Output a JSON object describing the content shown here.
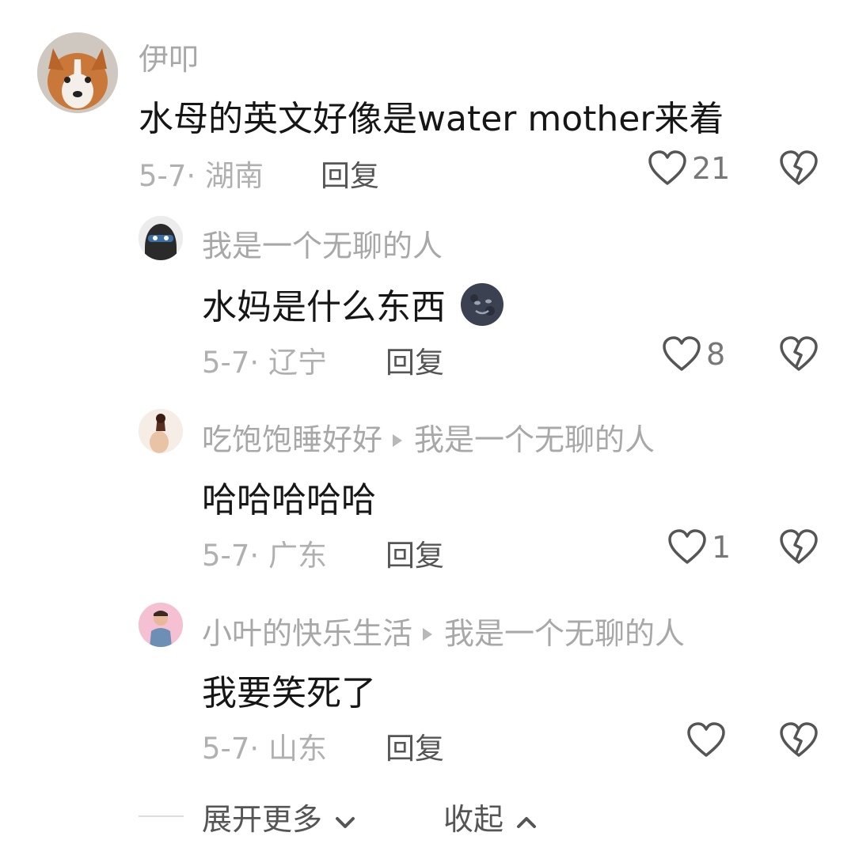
{
  "comments": [
    {
      "username": "伊叩",
      "text": "水母的英文好像是water mother来着",
      "date_location": "5-7· 湖南",
      "reply_label": "回复",
      "likes": "21",
      "reply_to": ""
    },
    {
      "username": "我是一个无聊的人",
      "text": "水妈是什么东西",
      "date_location": "5-7· 辽宁",
      "reply_label": "回复",
      "likes": "8",
      "reply_to": ""
    },
    {
      "username": "吃饱饱睡好好",
      "text": "哈哈哈哈哈",
      "date_location": "5-7· 广东",
      "reply_label": "回复",
      "likes": "1",
      "reply_to": "我是一个无聊的人"
    },
    {
      "username": "小叶的快乐生活",
      "text": "我要笑死了",
      "date_location": "5-7· 山东",
      "reply_label": "回复",
      "likes": "",
      "reply_to": "我是一个无聊的人"
    }
  ],
  "footer": {
    "expand_label": "展开更多",
    "collapse_label": "收起"
  },
  "colors": {
    "username": "#a8a8a8",
    "text": "#161616",
    "meta": "#b0b0b0",
    "icon": "#444444"
  }
}
